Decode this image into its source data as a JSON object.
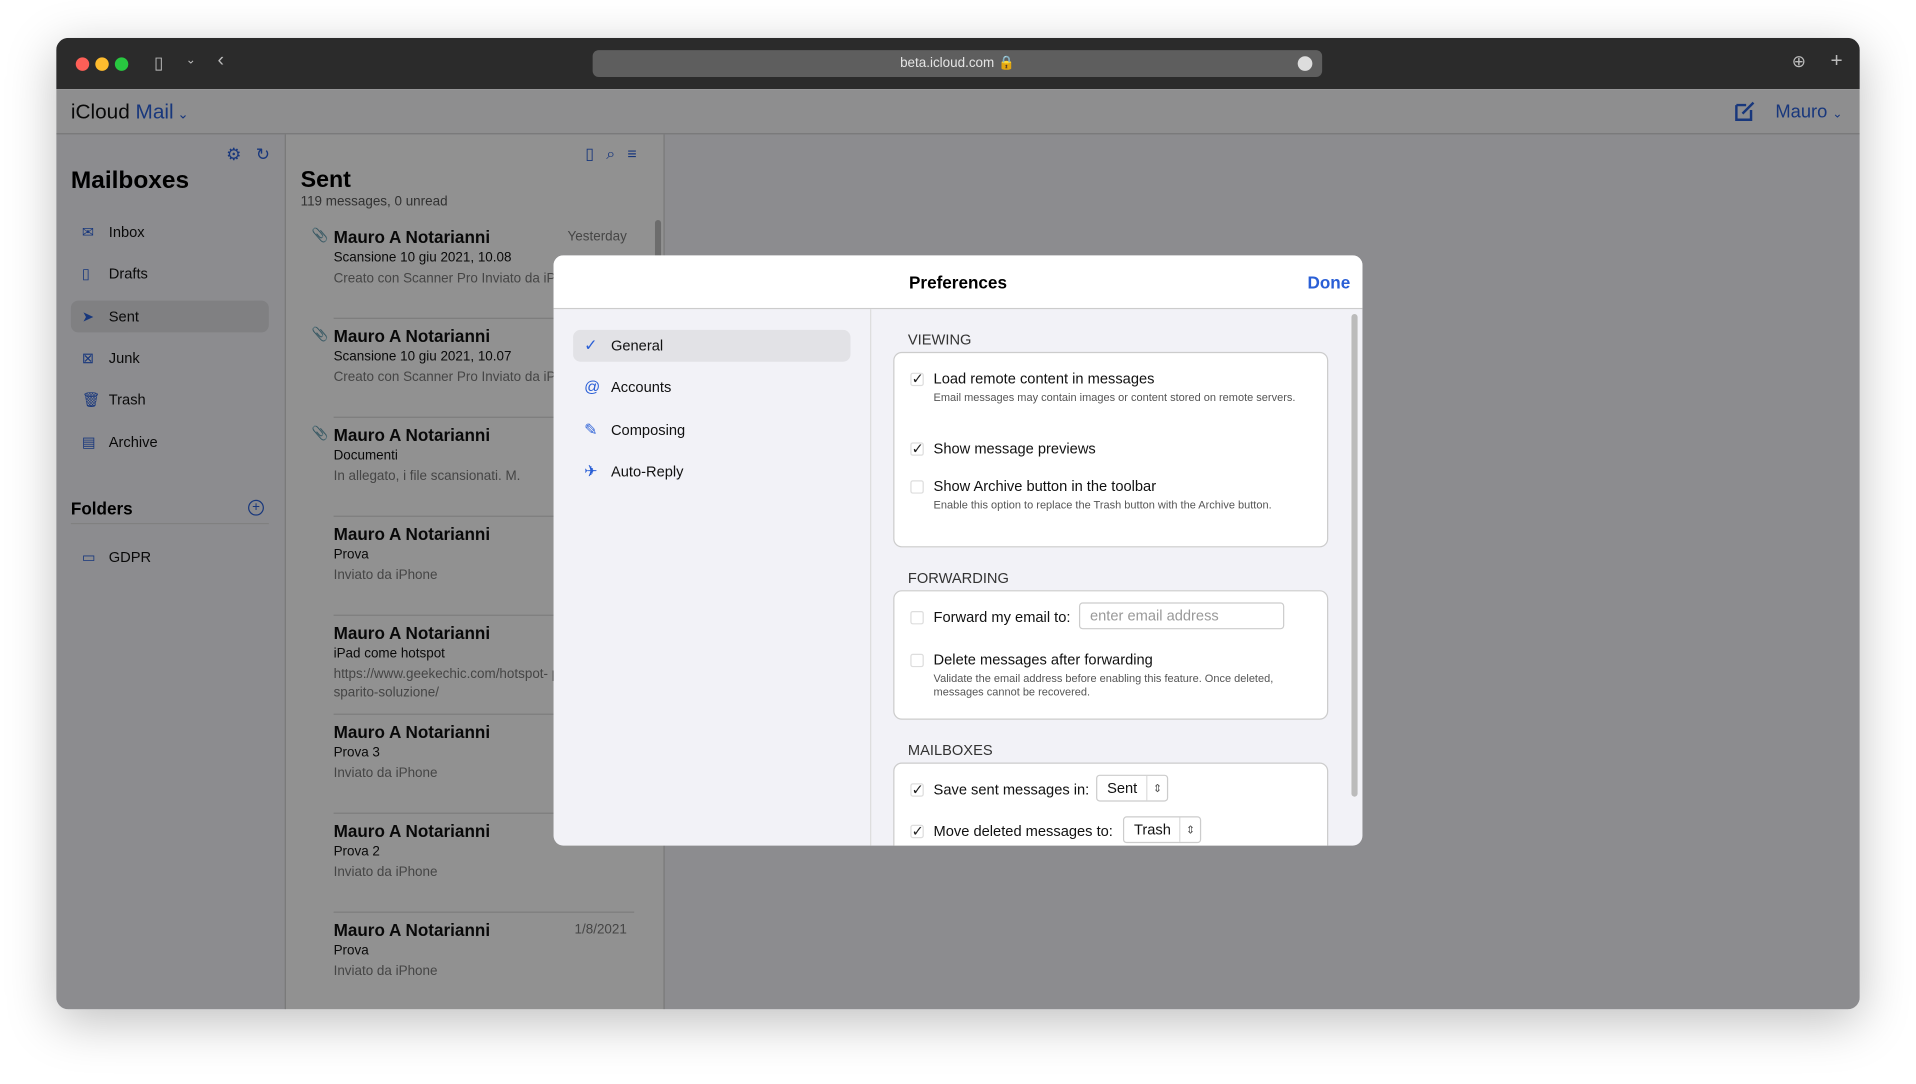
{
  "browser": {
    "url": "beta.icloud.com"
  },
  "app": {
    "brand": "iCloud",
    "product": "Mail",
    "user": "Mauro"
  },
  "sidebar": {
    "title": "Mailboxes",
    "items": [
      {
        "label": "Inbox",
        "icon": "inbox-icon"
      },
      {
        "label": "Drafts",
        "icon": "document-icon"
      },
      {
        "label": "Sent",
        "icon": "paperplane-icon"
      },
      {
        "label": "Junk",
        "icon": "junk-icon"
      },
      {
        "label": "Trash",
        "icon": "trash-icon"
      },
      {
        "label": "Archive",
        "icon": "archive-icon"
      }
    ],
    "folders_title": "Folders",
    "folders": [
      {
        "label": "GDPR"
      }
    ]
  },
  "list": {
    "title": "Sent",
    "count": "119 messages, 0 unread",
    "messages": [
      {
        "from": "Mauro A Notarianni",
        "date": "Yesterday",
        "subject": "Scansione 10 giu 2021, 10.08",
        "preview": "Creato con Scanner Pro Inviato da iPhone"
      },
      {
        "from": "Mauro A Notarianni",
        "date": "",
        "subject": "Scansione 10 giu 2021, 10.07",
        "preview": "Creato con Scanner Pro Inviato da iPhone"
      },
      {
        "from": "Mauro A Notarianni",
        "date": "",
        "subject": "Documenti",
        "preview": "In allegato, i file scansionati. M."
      },
      {
        "from": "Mauro A Notarianni",
        "date": "",
        "subject": "Prova",
        "preview": "Inviato da iPhone"
      },
      {
        "from": "Mauro A Notarianni",
        "date": "",
        "subject": "iPad come hotspot",
        "preview": "https://www.geekechic.com/hotspot- personale-sparito-soluzione/"
      },
      {
        "from": "Mauro A Notarianni",
        "date": "",
        "subject": "Prova 3",
        "preview": "Inviato da iPhone"
      },
      {
        "from": "Mauro A Notarianni",
        "date": "",
        "subject": "Prova 2",
        "preview": "Inviato da iPhone"
      },
      {
        "from": "Mauro A Notarianni",
        "date": "1/8/2021",
        "subject": "Prova",
        "preview": "Inviato da iPhone"
      }
    ]
  },
  "prefs": {
    "title": "Preferences",
    "done": "Done",
    "nav": [
      {
        "label": "General"
      },
      {
        "label": "Accounts"
      },
      {
        "label": "Composing"
      },
      {
        "label": "Auto-Reply"
      }
    ],
    "viewing": {
      "title": "VIEWING",
      "load_remote": "Load remote content in messages",
      "load_remote_desc": "Email messages may contain images or content stored on remote servers.",
      "show_previews": "Show message previews",
      "show_archive": "Show Archive button in the toolbar",
      "show_archive_desc": "Enable this option to replace the Trash button with the Archive button."
    },
    "forwarding": {
      "title": "FORWARDING",
      "forward": "Forward my email to:",
      "placeholder": "enter email address",
      "delete": "Delete messages after forwarding",
      "delete_desc": "Validate the email address before enabling this feature. Once deleted, messages cannot be recovered."
    },
    "mailboxes": {
      "title": "MAILBOXES",
      "save_sent": "Save sent messages in:",
      "save_sent_value": "Sent",
      "move_deleted": "Move deleted messages to:",
      "move_deleted_value": "Trash"
    }
  }
}
